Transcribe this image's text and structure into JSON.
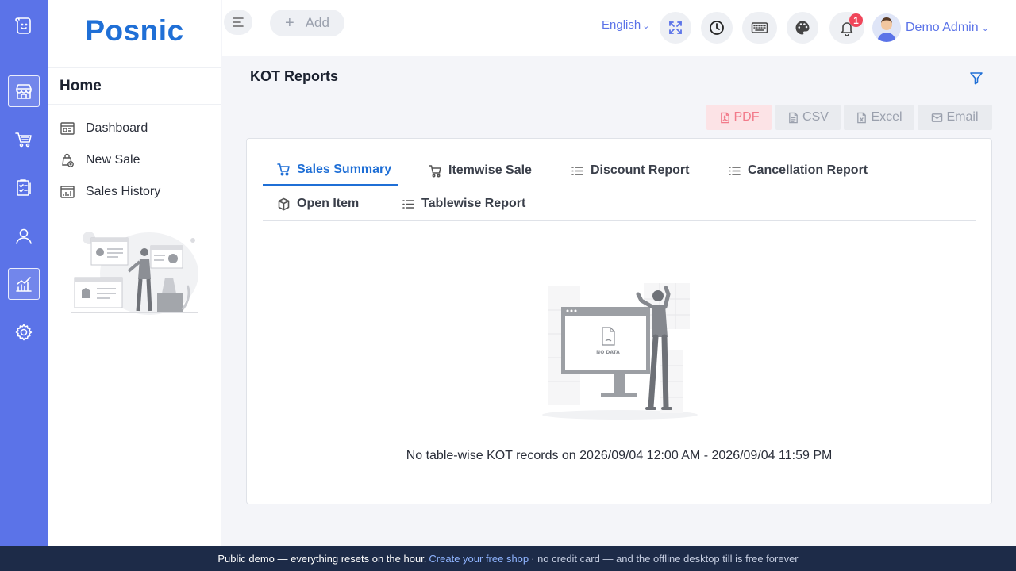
{
  "brand": {
    "name": "Posnic"
  },
  "rail": {
    "items": [
      {
        "icon": "store-icon",
        "active": true
      },
      {
        "icon": "cart-icon",
        "active": false
      },
      {
        "icon": "clipboard-icon",
        "active": false
      },
      {
        "icon": "user-icon",
        "active": false
      },
      {
        "icon": "chart-icon",
        "active": true
      },
      {
        "icon": "gear-icon",
        "active": false
      }
    ]
  },
  "sidebar": {
    "header": "Home",
    "items": [
      {
        "label": "Dashboard",
        "icon": "dashboard-icon"
      },
      {
        "label": "New Sale",
        "icon": "new-sale-icon"
      },
      {
        "label": "Sales History",
        "icon": "sales-history-icon"
      }
    ]
  },
  "topbar": {
    "add_label": "Add",
    "language": "English",
    "notification_count": "1",
    "user_name": "Demo Admin"
  },
  "page": {
    "title": "KOT Reports",
    "exports": [
      {
        "label": "PDF",
        "icon": "pdf-icon"
      },
      {
        "label": "CSV",
        "icon": "csv-icon"
      },
      {
        "label": "Excel",
        "icon": "excel-icon"
      },
      {
        "label": "Email",
        "icon": "email-icon"
      }
    ],
    "tabs": [
      {
        "label": "Sales Summary",
        "icon": "cart-icon",
        "active": true
      },
      {
        "label": "Itemwise Sale",
        "icon": "cart-icon",
        "active": false
      },
      {
        "label": "Discount Report",
        "icon": "list-icon",
        "active": false
      },
      {
        "label": "Cancellation Report",
        "icon": "list-icon",
        "active": false
      },
      {
        "label": "Open Item",
        "icon": "box-icon",
        "active": false
      },
      {
        "label": "Tablewise Report",
        "icon": "list-icon",
        "active": false
      }
    ],
    "empty_illustration_text": "NO DATA",
    "empty_message": "No table-wise KOT records on 2026/09/04 12:00 AM - 2026/09/04 11:59 PM"
  },
  "footer": {
    "text_before": "Public demo — everything resets on the hour.",
    "link": "Create your free shop",
    "text_after": "· no credit card — and the offline desktop till is free forever"
  },
  "colors": {
    "rail": "#5b73e8",
    "brand": "#1f6fd6",
    "accent": "#5b73e8",
    "badge": "#f0465a",
    "footer": "#1d2b48"
  }
}
